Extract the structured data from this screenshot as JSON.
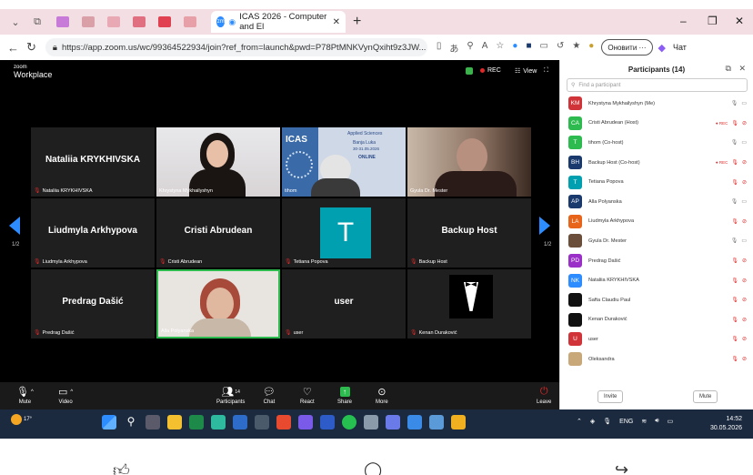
{
  "browser": {
    "active_tab_title": "ICAS 2026 - Computer and El",
    "url": "https://app.zoom.us/wc/99364522934/join?ref_from=launch&pwd=P78PtMNKVynQxiht9z3JW...",
    "update_button": "Оновити",
    "chat_label": "Чат"
  },
  "zoom": {
    "logo_top": "zoom",
    "logo_bottom": "Workplace",
    "rec_label": "REC",
    "view_label": "View",
    "page_left": "1/2",
    "page_right": "1/2",
    "tiles": [
      {
        "big_name": "Nataliia KRYKHIVSKA",
        "label": "Nataliia KRYKHIVSKA",
        "muted": true
      },
      {
        "big_name": "",
        "label": "Khrystyna Mykhailyshyn",
        "muted": false,
        "video": "woman-dark-hair"
      },
      {
        "big_name": "",
        "label": "tihom",
        "muted": false,
        "video": "icas-banner"
      },
      {
        "big_name": "",
        "label": "Gyula Dr. Mester",
        "muted": false,
        "video": "man-glasses"
      },
      {
        "big_name": "Liudmyla Arkhypova",
        "label": "Liudmyla Arkhypova",
        "muted": true
      },
      {
        "big_name": "Cristi Abrudean",
        "label": "Cristi Abrudean",
        "muted": true
      },
      {
        "big_name": "",
        "label": "Tetiana Popova",
        "muted": true,
        "avatar_letter": "T"
      },
      {
        "big_name": "Backup Host",
        "label": "Backup Host",
        "muted": true
      },
      {
        "big_name": "Predrag Dašić",
        "label": "Predrag Dašić",
        "muted": true
      },
      {
        "big_name": "",
        "label": "Alla Polyanska",
        "muted": false,
        "video": "woman-red-hair"
      },
      {
        "big_name": "user",
        "label": "user",
        "muted": true
      },
      {
        "big_name": "",
        "label": "Kenan Duraković",
        "muted": true,
        "video": "tuxedo"
      }
    ],
    "banner_text": [
      "ICAS",
      "Applied Sciences",
      "Banja Luka",
      "30-31.05.2026",
      "ONLINE"
    ],
    "toolbar": {
      "mute": "Mute",
      "video": "Video",
      "participants": "Participants",
      "participants_count": "14",
      "chat": "Chat",
      "react": "React",
      "share": "Share",
      "more": "More",
      "leave": "Leave"
    }
  },
  "panel": {
    "title": "Participants (14)",
    "search_placeholder": "Find a participant",
    "invite": "Invite",
    "mute": "Mute",
    "participants": [
      {
        "initials": "KM",
        "name": "Khrystyna Mykhailyshyn (Me)",
        "color": "#d13438",
        "mic": "on",
        "cam": "on",
        "rec": false
      },
      {
        "initials": "CA",
        "name": "Cristi Abrudean (Host)",
        "color": "#2dba4e",
        "mic": "off",
        "cam": "off",
        "rec": true
      },
      {
        "initials": "T",
        "name": "tihom (Co-host)",
        "color": "#2dba4e",
        "mic": "on",
        "cam": "on",
        "rec": false
      },
      {
        "initials": "BH",
        "name": "Backup Host (Co-host)",
        "color": "#1a3a6e",
        "mic": "off",
        "cam": "off",
        "rec": true
      },
      {
        "initials": "T",
        "name": "Tetiana Popova",
        "color": "#00a0b0",
        "mic": "off",
        "cam": "off",
        "rec": false
      },
      {
        "initials": "AP",
        "name": "Alla Polyanska",
        "color": "#1a3a6e",
        "mic": "on",
        "cam": "on",
        "rec": false
      },
      {
        "initials": "LA",
        "name": "Liudmyla Arkhypova",
        "color": "#e8641a",
        "mic": "off",
        "cam": "off",
        "rec": false
      },
      {
        "initials": "",
        "name": "Gyula Dr. Mester",
        "color": "#6b4f3a",
        "mic": "on",
        "cam": "on",
        "rec": false
      },
      {
        "initials": "PD",
        "name": "Predrag Dašić",
        "color": "#9b30c8",
        "mic": "off",
        "cam": "off",
        "rec": false
      },
      {
        "initials": "NK",
        "name": "Nataliia KRYKHIVSKA",
        "color": "#2d8cff",
        "mic": "off",
        "cam": "off",
        "rec": false
      },
      {
        "initials": "",
        "name": "Safta Claudiu Paul",
        "color": "#111111",
        "mic": "off",
        "cam": "off",
        "rec": false
      },
      {
        "initials": "",
        "name": "Kenan Duraković",
        "color": "#111111",
        "mic": "off",
        "cam": "off",
        "rec": false
      },
      {
        "initials": "U",
        "name": "user",
        "color": "#d13438",
        "mic": "off",
        "cam": "off",
        "rec": false
      },
      {
        "initials": "",
        "name": "Oleksandra",
        "color": "#c8a878",
        "mic": "off",
        "cam": "off",
        "rec": false
      }
    ]
  },
  "taskbar": {
    "temperature": "17°",
    "language": "ENG",
    "time": "14:52",
    "date": "30.05.2026"
  }
}
